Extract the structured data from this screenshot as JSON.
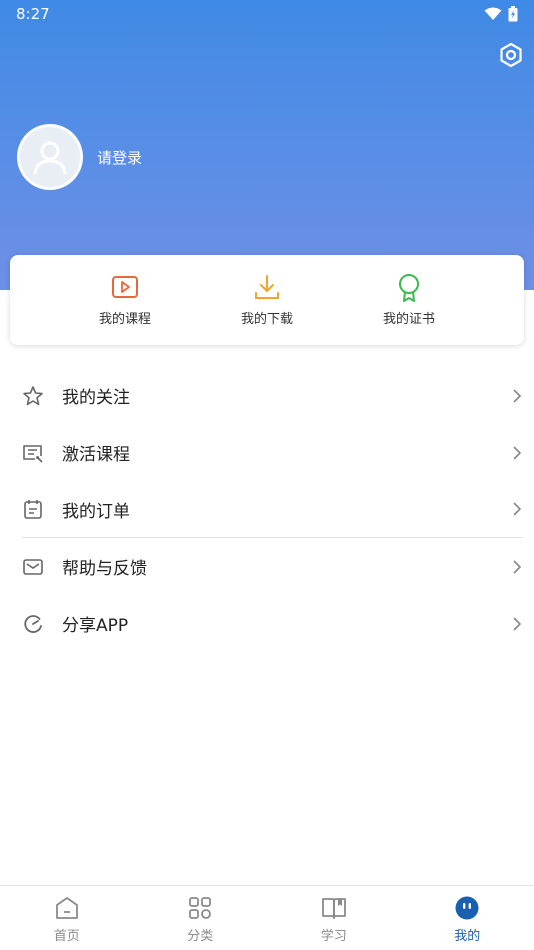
{
  "status_bar": {
    "time": "8:27"
  },
  "profile": {
    "login_text": "请登录"
  },
  "quick_actions": [
    {
      "label": "我的课程",
      "icon": "play-video-icon",
      "color": "#e8683a"
    },
    {
      "label": "我的下载",
      "icon": "download-icon",
      "color": "#f0a52a"
    },
    {
      "label": "我的证书",
      "icon": "certificate-icon",
      "color": "#3cba4f"
    }
  ],
  "menu": [
    {
      "label": "我的关注",
      "icon": "star-icon"
    },
    {
      "label": "激活课程",
      "icon": "activate-card-icon"
    },
    {
      "label": "我的订单",
      "icon": "order-list-icon"
    },
    {
      "label": "帮助与反馈",
      "icon": "mail-icon"
    },
    {
      "label": "分享APP",
      "icon": "share-refresh-icon"
    }
  ],
  "tabs": [
    {
      "label": "首页",
      "icon": "home-icon",
      "active": false
    },
    {
      "label": "分类",
      "icon": "grid-icon",
      "active": false
    },
    {
      "label": "学习",
      "icon": "book-icon",
      "active": false
    },
    {
      "label": "我的",
      "icon": "profile-face-icon",
      "active": true
    }
  ],
  "colors": {
    "header_top": "#3f8ae6",
    "header_bottom": "#6f8fe6",
    "active_tab": "#1a5fb0"
  }
}
